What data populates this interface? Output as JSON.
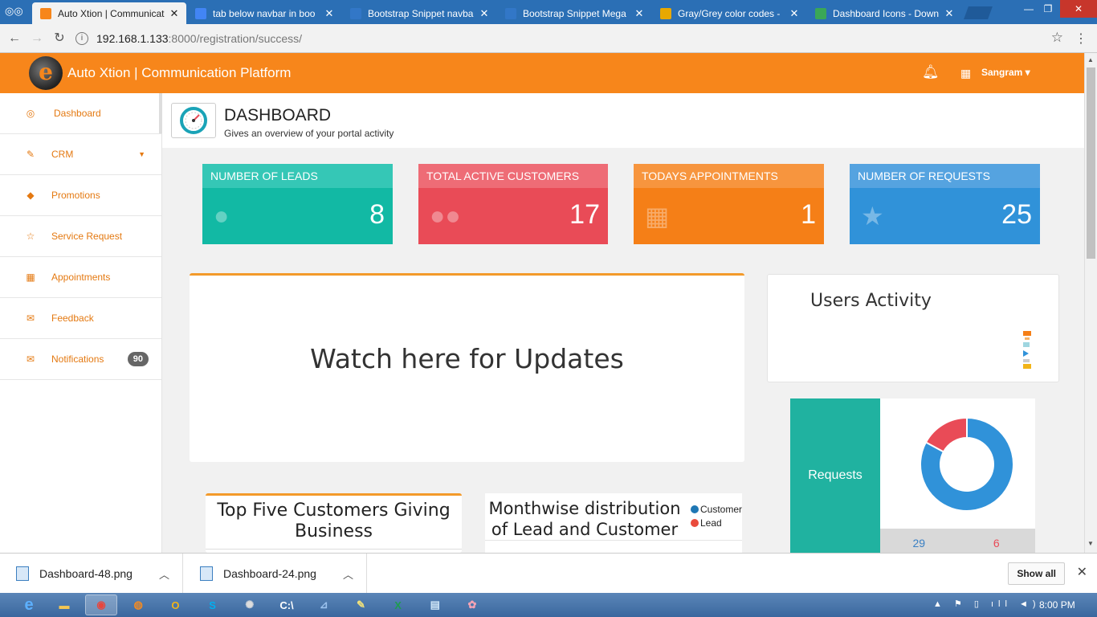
{
  "browser": {
    "tabs": [
      {
        "title": "Auto Xtion | Communicat",
        "favicon_color": "#f7861b",
        "active": true
      },
      {
        "title": "tab below navbar in boo",
        "favicon_color": "#4285f4",
        "active": false
      },
      {
        "title": "Bootstrap Snippet navba",
        "favicon_color": "#3277c7",
        "active": false
      },
      {
        "title": "Bootstrap Snippet Mega",
        "favicon_color": "#3277c7",
        "active": false
      },
      {
        "title": "Gray/Grey color codes -",
        "favicon_color": "#e8a800",
        "active": false
      },
      {
        "title": "Dashboard Icons - Down",
        "favicon_color": "#3aa757",
        "active": false
      }
    ],
    "url_host": "192.168.1.133",
    "url_path": ":8000/registration/success/"
  },
  "app": {
    "logo_letter": "e",
    "title": "Auto Xtion | Communication Platform",
    "user_name": "Sangram ▾"
  },
  "sidebar": {
    "items": [
      {
        "label": "Dashboard",
        "icon": "gauge-icon",
        "glyph": "◎"
      },
      {
        "label": "CRM",
        "icon": "edit-icon",
        "glyph": "✎"
      },
      {
        "label": "Promotions",
        "icon": "tags-icon",
        "glyph": "◆"
      },
      {
        "label": "Service Request",
        "icon": "star-icon",
        "glyph": "☆"
      },
      {
        "label": "Appointments",
        "icon": "calendar-icon",
        "glyph": "▦"
      },
      {
        "label": "Feedback",
        "icon": "envelope-icon",
        "glyph": "✉"
      },
      {
        "label": "Notifications",
        "icon": "envelope-icon",
        "glyph": "✉",
        "badge": "90"
      }
    ]
  },
  "page": {
    "title": "DASHBOARD",
    "subtitle": "Gives an overview of your portal activity"
  },
  "cards": [
    {
      "label": "NUMBER OF LEADS",
      "value": "8",
      "icon": "user-icon",
      "glyph": "●",
      "head_color": "#35c7b6",
      "body_color": "#12b9a4"
    },
    {
      "label": "TOTAL ACTIVE CUSTOMERS",
      "value": "17",
      "icon": "users-icon",
      "glyph": "●●",
      "head_color": "#ee6c76",
      "body_color": "#e94b57"
    },
    {
      "label": "TODAYS APPOINTMENTS",
      "value": "1",
      "icon": "calendar-icon",
      "glyph": "▦",
      "head_color": "#f7953e",
      "body_color": "#f57f17"
    },
    {
      "label": "NUMBER OF REQUESTS",
      "value": "25",
      "icon": "star-icon",
      "glyph": "★",
      "head_color": "#55a3e0",
      "body_color": "#3092d9"
    }
  ],
  "updates": {
    "text": "Watch here for Updates"
  },
  "activity": {
    "title": "Users Activity"
  },
  "requests": {
    "label": "Requests",
    "stats": [
      {
        "value": "29",
        "color": "#3a80c4"
      },
      {
        "value": "6",
        "color": "#e94b57"
      }
    ],
    "donut": [
      {
        "value": 29,
        "color": "#3092d9"
      },
      {
        "value": 6,
        "color": "#e94b57"
      }
    ]
  },
  "panels": {
    "top_five_title": "Top Five Customers Giving Business",
    "monthwise_title": "Monthwise distribution of Lead and Customer",
    "legend": [
      {
        "label": "Customer",
        "color": "#1f77b4"
      },
      {
        "label": "Lead",
        "color": "#e94b3c"
      }
    ]
  },
  "downloads": {
    "files": [
      "Dashboard-48.png",
      "Dashboard-24.png"
    ],
    "show_all": "Show all"
  },
  "taskbar": {
    "apps": [
      {
        "icon": "chrome-icon",
        "glyph": "◉",
        "active": true
      },
      {
        "icon": "firefox-icon",
        "glyph": "◍",
        "active": false
      },
      {
        "icon": "outlook-icon",
        "glyph": "O",
        "active": false
      },
      {
        "icon": "skype-icon",
        "glyph": "S",
        "active": false
      },
      {
        "icon": "settings-icon",
        "glyph": "✺",
        "active": false
      },
      {
        "icon": "cmd-icon",
        "glyph": "C:\\",
        "active": false
      },
      {
        "icon": "tool-icon",
        "glyph": "⊿",
        "active": false
      },
      {
        "icon": "notepad-icon",
        "glyph": "✎",
        "active": false
      },
      {
        "icon": "excel-icon",
        "glyph": "X",
        "active": false
      },
      {
        "icon": "notes-icon",
        "glyph": "▤",
        "active": false
      },
      {
        "icon": "paint-icon",
        "glyph": "✿",
        "active": false
      }
    ],
    "clock": "8:00 PM"
  }
}
